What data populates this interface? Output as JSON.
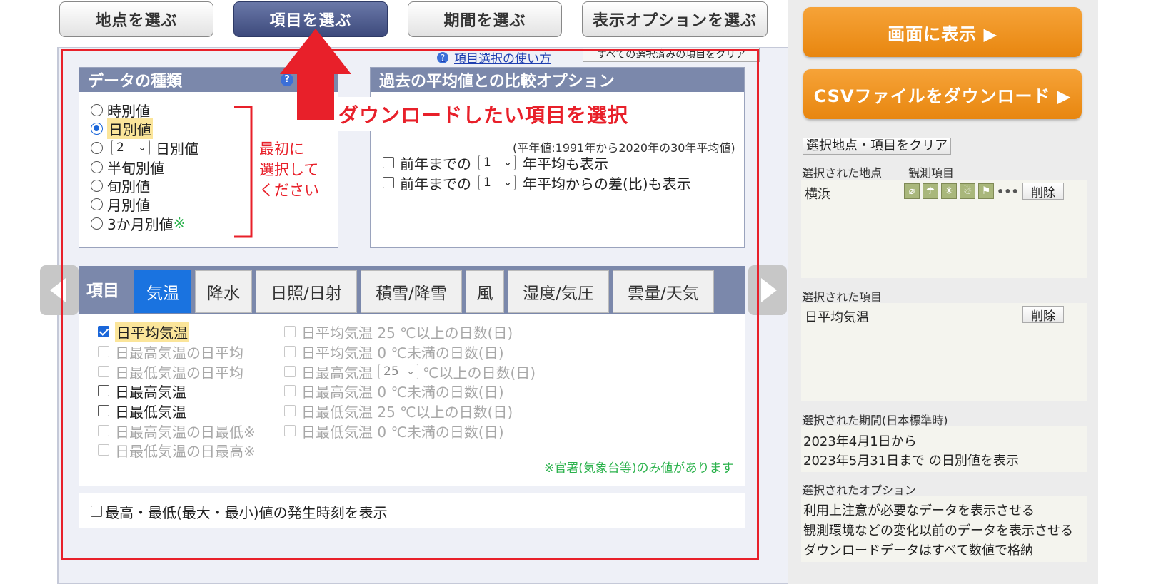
{
  "top_tabs": [
    {
      "label": "地点を選ぶ",
      "active": false
    },
    {
      "label": "項目を選ぶ",
      "active": true
    },
    {
      "label": "期間を選ぶ",
      "active": false
    },
    {
      "label": "表示オプションを選ぶ",
      "active": false
    }
  ],
  "help_link": "項目選択の使い方",
  "clear_all_label": "すべての選択済みの項目をクリア",
  "data_type": {
    "title": "データの種類",
    "help_icon": "question-icon",
    "options": [
      {
        "label": "時別値",
        "checked": false
      },
      {
        "label": "日別値",
        "checked": true
      },
      {
        "label": "日別値",
        "checked": false,
        "select_value": "2"
      },
      {
        "label": "半旬別値",
        "checked": false
      },
      {
        "label": "旬別値",
        "checked": false
      },
      {
        "label": "月別値",
        "checked": false
      },
      {
        "label": "3か月別値",
        "checked": false,
        "note": "※"
      }
    ]
  },
  "annotation": {
    "bracket_text_1": "最初に",
    "bracket_text_2": "選択して",
    "bracket_text_3": "ください",
    "arrow_text": "ダウンロードしたい項目を選択",
    "color": "#e8202a"
  },
  "comparison": {
    "title": "過去の平均値との比較オプション",
    "normal_note": "(平年値:1991年から2020年の30年平均値)",
    "opt1": {
      "prefix": "前年までの",
      "value": "1",
      "suffix": "年平均も表示"
    },
    "opt2": {
      "prefix": "前年までの",
      "value": "1",
      "suffix": "年平均からの差(比)も表示"
    }
  },
  "items_tabs": {
    "label": "項目",
    "tabs": [
      "気温",
      "降水",
      "日照/日射",
      "積雪/降雪",
      "風",
      "湿度/気圧",
      "雲量/天気"
    ],
    "active": "気温"
  },
  "left_items": [
    {
      "label": "日平均気温",
      "checked": true,
      "disabled": false
    },
    {
      "label": "日最高気温の日平均",
      "checked": false,
      "disabled": true
    },
    {
      "label": "日最低気温の日平均",
      "checked": false,
      "disabled": true
    },
    {
      "label": "日最高気温",
      "checked": false,
      "disabled": false
    },
    {
      "label": "日最低気温",
      "checked": false,
      "disabled": false
    },
    {
      "label": "日最高気温の日最低※",
      "checked": false,
      "disabled": true
    },
    {
      "label": "日最低気温の日最高※",
      "checked": false,
      "disabled": true
    }
  ],
  "right_items": [
    {
      "label": "日平均気温 25 ℃以上の日数(日)"
    },
    {
      "label": "日平均気温 0 ℃未満の日数(日)"
    },
    {
      "prefix": "日最高気温",
      "select": "25",
      "suffix": "℃以上の日数(日)"
    },
    {
      "label": "日最高気温 0 ℃未満の日数(日)"
    },
    {
      "label": "日最低気温 25 ℃以上の日数(日)"
    },
    {
      "label": "日最低気温 0 ℃未満の日数(日)"
    }
  ],
  "official_note": "※官署(気象台等)のみ値があります",
  "time_option": "最高・最低(最大・最小)値の発生時刻を表示",
  "sidebar": {
    "show_button": "画面に表示 ▶",
    "csv_button": "CSVファイルをダウンロード ▶",
    "clear_button": "選択地点・項目をクリア",
    "station_label": "選択された地点",
    "obs_label": "観測項目",
    "station_name": "横浜",
    "station_icons_more": "•••",
    "delete_label": "削除",
    "item_label": "選択された項目",
    "item_value": "日平均気温",
    "period_label": "選択された期間(日本標準時)",
    "period_from": "2023年4月1日から",
    "period_to": "2023年5月31日まで の日別値を表示",
    "option_label": "選択されたオプション",
    "options": [
      "利用上注意が必要なデータを表示させる",
      "観測環境などの変化以前のデータを表示させる",
      "ダウンロードデータはすべて数値で格納"
    ]
  }
}
